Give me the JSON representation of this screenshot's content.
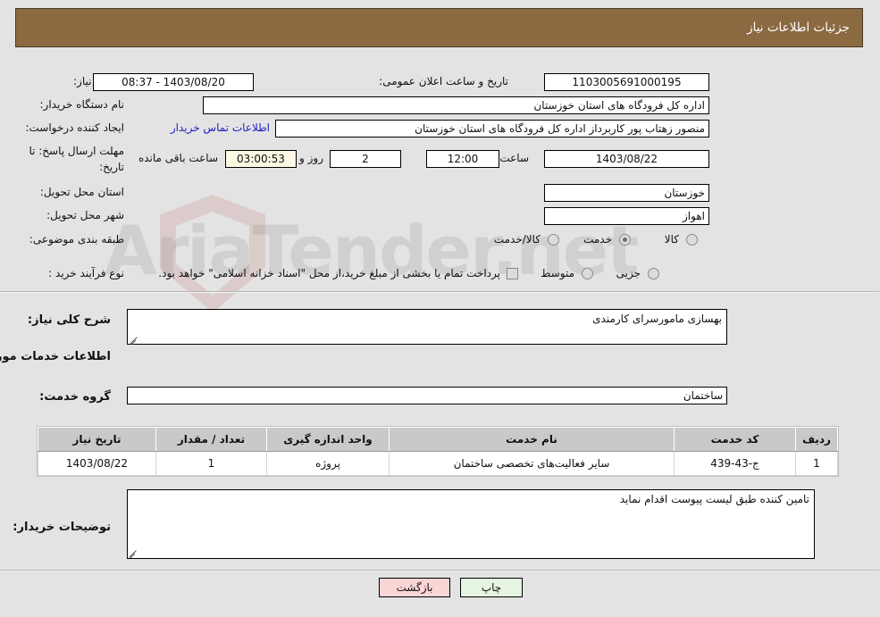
{
  "header": {
    "title": "جزئیات اطلاعات نیاز",
    "bg_color": "#8b6a41",
    "text_color": "#ffffff"
  },
  "watermark": {
    "text": "AriaTender.net"
  },
  "need_info": {
    "need_number_label": "شماره نیاز:",
    "need_number_value": "1103005691000195",
    "announce_datetime_label": "تاریخ و ساعت اعلان عمومی:",
    "announce_datetime_value": "08:37 - 1403/08/20",
    "buyer_org_label": "نام دستگاه خریدار:",
    "buyer_org_value": "اداره کل فرودگاه های استان خوزستان",
    "requester_label": "ایجاد کننده درخواست:",
    "requester_value": "منصور زهتاب پور کاربرداز اداره کل فرودگاه های استان خوزستان",
    "buyer_contact_link": "اطلاعات تماس خریدار",
    "deadline_label_line1": "مهلت ارسال پاسخ: تا",
    "deadline_label_line2": "تاریخ:",
    "deadline_date": "1403/08/22",
    "deadline_hour_label": "ساعت",
    "deadline_hour_value": "12:00",
    "remaining_days_value": "2",
    "remaining_days_label": "روز و",
    "remaining_time_value": "03:00:53",
    "remaining_time_label": "ساعت باقی مانده",
    "province_label": "استان محل تحویل:",
    "province_value": "خوزستان",
    "city_label": "شهر محل تحویل:",
    "city_value": "اهواز",
    "category_label": "طبقه بندی موضوعی:",
    "category_options": [
      {
        "label": "کالا",
        "selected": false
      },
      {
        "label": "خدمت",
        "selected": true
      },
      {
        "label": "کالا/خدمت",
        "selected": false
      }
    ],
    "process_label": "نوع فرآیند خرید :",
    "process_options": [
      {
        "label": "جزیی",
        "selected": false
      },
      {
        "label": "متوسط",
        "selected": false
      }
    ],
    "treasury_checkbox_checked": false,
    "treasury_checkbox_label": "پرداخت تمام یا بخشی از مبلغ خرید،از محل \"اسناد خزانه اسلامی\" خواهد بود."
  },
  "description": {
    "general_label": "شرح کلی نیاز:",
    "general_value": "بهسازی مامورسرای کارمندی",
    "section_heading": "اطلاعات خدمات مورد نیاز",
    "service_group_label": "گروه خدمت:",
    "service_group_value": "ساختمان"
  },
  "table": {
    "columns": [
      "ردیف",
      "کد خدمت",
      "نام خدمت",
      "واحد اندازه گیری",
      "تعداد / مقدار",
      "تاریخ نیاز"
    ],
    "rows": [
      {
        "row_no": "1",
        "service_code": "ج-43-439",
        "service_name": "سایر فعالیت‌های تخصصی ساختمان",
        "unit": "پروژه",
        "quantity": "1",
        "need_date": "1403/08/22"
      }
    ]
  },
  "buyer_notes": {
    "label": "توضیحات خریدار:",
    "value": "تامین کننده طبق لیست پیوست اقدام نماید"
  },
  "footer": {
    "print_label": "چاپ",
    "back_label": "بازگشت",
    "print_bg": "#e5f5e2",
    "back_bg": "#fbd5d5"
  }
}
